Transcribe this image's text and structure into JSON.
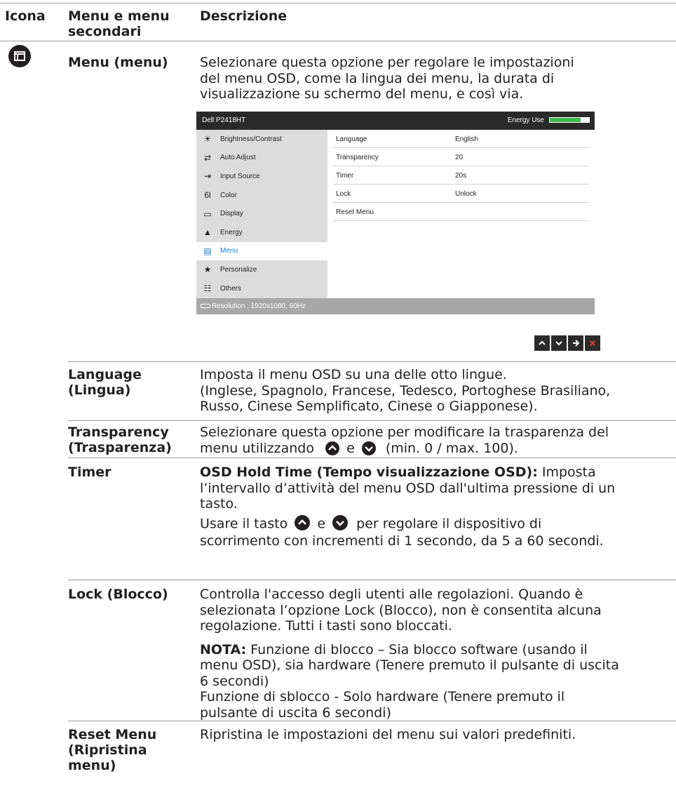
{
  "header": {
    "col_icon": "Icona",
    "col_menu_line1": "Menu e menu",
    "col_menu_line2": "secondari",
    "col_desc": "Descrizione"
  },
  "menu_row": {
    "label": "Menu (menu)",
    "desc_line1": "Selezionare questa opzione per regolare le impostazioni",
    "desc_line2": "del menu OSD, come la lingua dei menu, la durata di",
    "desc_line3": "visualizzazione su schermo del menu, e così via."
  },
  "osd": {
    "model": "Dell P2418HT",
    "energy_label": "Energy Use",
    "energy_level": 0.78,
    "left_menu": [
      {
        "label": "Brightness/Contrast",
        "icon": "brightness-icon"
      },
      {
        "label": "Auto Adjust",
        "icon": "auto-adjust-icon"
      },
      {
        "label": "Input Source",
        "icon": "input-source-icon"
      },
      {
        "label": "Color",
        "icon": "color-icon"
      },
      {
        "label": "Display",
        "icon": "display-icon"
      },
      {
        "label": "Energy",
        "icon": "energy-icon"
      },
      {
        "label": "Menu",
        "icon": "menu-icon",
        "selected": true
      },
      {
        "label": "Personalize",
        "icon": "star-icon"
      },
      {
        "label": "Others",
        "icon": "others-icon"
      }
    ],
    "settings": [
      {
        "key": "Language",
        "value": "English"
      },
      {
        "key": "Transparency",
        "value": "20"
      },
      {
        "key": "Timer",
        "value": "20s"
      },
      {
        "key": "Lock",
        "value": "Unlock"
      },
      {
        "key": "Reset Menu",
        "value": ""
      }
    ],
    "status": "Resolution : 1920x1080, 60Hz",
    "selected_color": "#1c7ec2"
  },
  "nav_buttons": [
    "up-arrow-icon",
    "down-arrow-icon",
    "right-arrow-icon",
    "close-icon"
  ],
  "rows": {
    "language": {
      "label1": "Language",
      "label2": "(Lingua)",
      "line1": "Imposta il menu OSD su una delle otto lingue.",
      "line2": "(Inglese, Spagnolo, Francese, Tedesco, Portoghese Brasiliano,",
      "line3": "Russo, Cinese Semplificato, Cinese o Giapponese)."
    },
    "transparency": {
      "label1": "Transparency",
      "label2": "(Trasparenza)",
      "line1": "Selezionare questa opzione per modificare la trasparenza del",
      "line2a": "menu utilizzando",
      "line2b": "e",
      "line2c": "(min. 0 / max. 100)."
    },
    "timer": {
      "label": "Timer",
      "bold": "OSD Hold Time (Tempo visualizzazione OSD):",
      "line1": "Imposta",
      "line2": "l’intervallo d’attività del menu OSD dall'ultima pressione di un",
      "line3": "tasto.",
      "line4a": "Usare il tasto",
      "line4b": "e",
      "line4c": "per regolare il dispositivo di",
      "line5": "scorrimento con incrementi di 1 secondo, da 5 a 60 secondi."
    },
    "lock": {
      "label": "Lock (Blocco)",
      "line1": "Controlla l'accesso degli utenti alle regolazioni. Quando è",
      "line2": "selezionata l’opzione Lock (Blocco), non è consentita alcuna",
      "line3": "regolazione. Tutti i tasti sono bloccati.",
      "note_bold": "NOTA:",
      "note1": "Funzione di blocco – Sia blocco software (usando il",
      "note2": "menu OSD), sia hardware (Tenere premuto il pulsante di uscita",
      "note3": "6 secondi)",
      "note4": "Funzione di sblocco - Solo hardware (Tenere premuto il",
      "note5": "pulsante di uscita 6 secondi)"
    },
    "reset": {
      "label1": "Reset Menu",
      "label2": "(Ripristina",
      "label3": "menu)",
      "line1": "Ripristina le impostazioni del menu sui valori predefiniti."
    }
  }
}
